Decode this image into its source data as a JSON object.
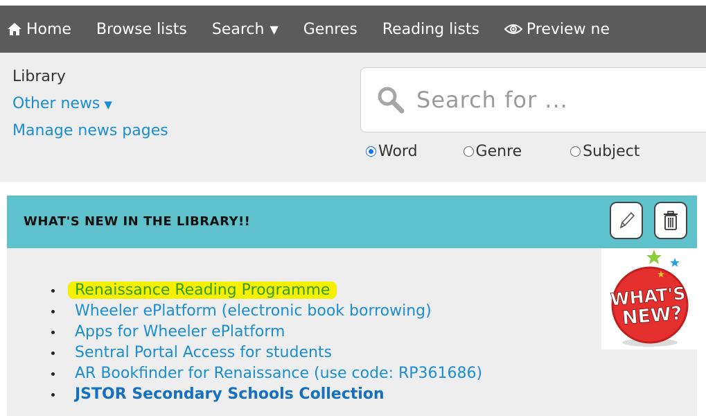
{
  "nav": {
    "home": "Home",
    "browse": "Browse lists",
    "search": "Search",
    "genres": "Genres",
    "reading_lists": "Reading lists",
    "preview": "Preview ne"
  },
  "sidebar": {
    "library": "Library",
    "other_news": "Other news",
    "manage": "Manage news pages"
  },
  "search": {
    "placeholder": "Search for ...",
    "options": [
      "Word",
      "Genre",
      "Subject"
    ],
    "selected": "Word"
  },
  "news": {
    "title": "WHAT'S NEW IN THE LIBRARY!!",
    "image_text": [
      "WHAT'S",
      "NEW?"
    ],
    "items": [
      "Renaissance Reading Programme",
      "Wheeler ePlatform (electronic book borrowing)",
      "Apps for Wheeler ePlatform",
      "Sentral Portal Access for students",
      "AR Bookfinder for Renaissance (use code: RP361686)",
      "JSTOR Secondary Schools Collection"
    ]
  },
  "colors": {
    "nav_bg": "#5b5b5b",
    "header_teal": "#5fc1cc",
    "link_blue": "#1a8ed0",
    "highlight": "#f4f000"
  }
}
